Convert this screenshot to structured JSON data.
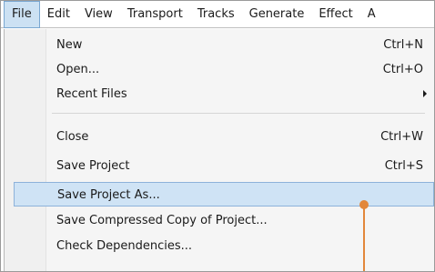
{
  "menubar": {
    "items": [
      {
        "label": "File",
        "active": true
      },
      {
        "label": "Edit"
      },
      {
        "label": "View"
      },
      {
        "label": "Transport"
      },
      {
        "label": "Tracks"
      },
      {
        "label": "Generate"
      },
      {
        "label": "Effect"
      },
      {
        "label": "A"
      }
    ]
  },
  "file_menu": {
    "items": [
      {
        "label": "New",
        "shortcut": "Ctrl+N"
      },
      {
        "label": "Open...",
        "shortcut": "Ctrl+O"
      },
      {
        "label": "Recent Files",
        "submenu": true
      },
      {
        "label": "Close",
        "shortcut": "Ctrl+W"
      },
      {
        "label": "Save Project",
        "shortcut": "Ctrl+S"
      },
      {
        "label": "Save Project As...",
        "highlighted": true
      },
      {
        "label": "Save Compressed Copy of Project..."
      },
      {
        "label": "Check Dependencies..."
      }
    ]
  },
  "colors": {
    "highlight": "#cfe3f5",
    "callout": "#e2873b"
  }
}
